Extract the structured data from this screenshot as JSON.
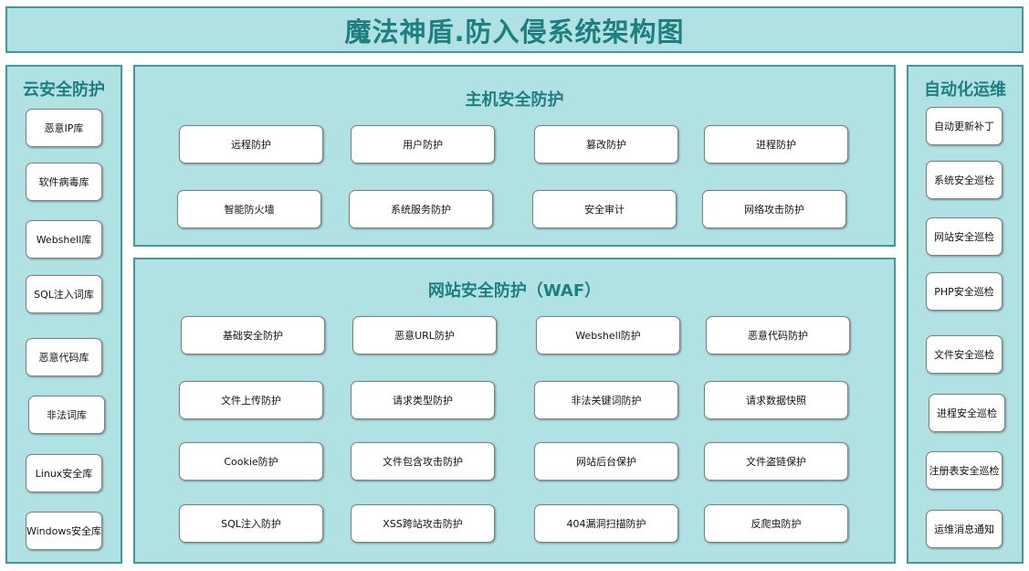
{
  "title": "魔法神盾.防入侵系统架构图",
  "cloud": {
    "heading": "云安全防护",
    "items": [
      "恶意IP库",
      "软件病毒库",
      "Webshell库",
      "SQL注入词库",
      "恶意代码库",
      "非法词库",
      "Linux安全库",
      "Windows安全库"
    ]
  },
  "host": {
    "heading": "主机安全防护",
    "items": [
      "远程防护",
      "用户防护",
      "篡改防护",
      "进程防护",
      "智能防火墙",
      "系统服务防护",
      "安全审计",
      "网络攻击防护"
    ]
  },
  "waf": {
    "heading": "网站安全防护（WAF）",
    "items": [
      "基础安全防护",
      "恶意URL防护",
      "Webshell防护",
      "恶意代码防护",
      "文件上传防护",
      "请求类型防护",
      "非法关键词防护",
      "请求数据快照",
      "Cookie防护",
      "文件包含攻击防护",
      "网站后台保护",
      "文件盗链保护",
      "SQL注入防护",
      "XSS跨站攻击防护",
      "404漏洞扫描防护",
      "反爬虫防护"
    ]
  },
  "ops": {
    "heading": "自动化运维",
    "items": [
      "自动更新补丁",
      "系统安全巡检",
      "网站安全巡检",
      "PHP安全巡检",
      "文件安全巡检",
      "进程安全巡检",
      "注册表安全巡检",
      "运维消息通知"
    ]
  }
}
